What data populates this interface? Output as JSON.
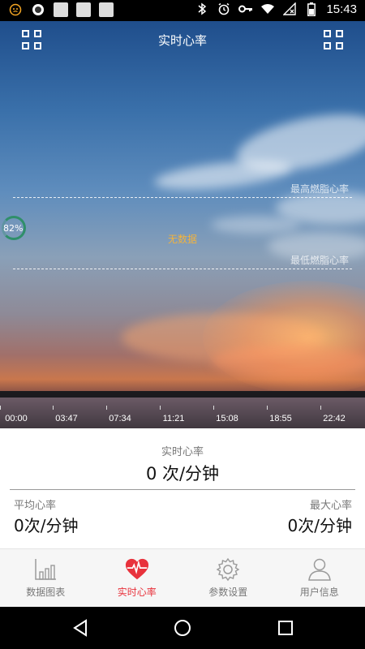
{
  "status_bar": {
    "time": "15:43",
    "left_icons": [
      "notification-face-icon",
      "record-icon",
      "app-square-icon",
      "app-square-icon",
      "app-square-icon"
    ],
    "right_icons": [
      "bluetooth-icon",
      "alarm-icon",
      "key-icon",
      "wifi-icon",
      "signal-off-icon",
      "battery-icon"
    ]
  },
  "header": {
    "title": "实时心率",
    "left_icon": "grid-icon",
    "right_icon": "grid-icon"
  },
  "chart": {
    "upper_line_label": "最高燃脂心率",
    "lower_line_label": "最低燃脂心率",
    "no_data_text": "无数据",
    "battery_percent": "82%",
    "x_ticks": [
      "00:00",
      "03:47",
      "07:34",
      "11:21",
      "15:08",
      "18:55",
      "22:42"
    ]
  },
  "readings": {
    "realtime_label": "实时心率",
    "realtime_value": "0 次/分钟",
    "average_label": "平均心率",
    "average_value": "0次/分钟",
    "max_label": "最大心率",
    "max_value": "0次/分钟"
  },
  "tabs": [
    {
      "label": "数据图表",
      "icon": "bar-chart-icon",
      "active": false
    },
    {
      "label": "实时心率",
      "icon": "heart-rate-icon",
      "active": true
    },
    {
      "label": "参数设置",
      "icon": "gear-icon",
      "active": false
    },
    {
      "label": "用户信息",
      "icon": "user-icon",
      "active": false
    }
  ],
  "colors": {
    "accent": "#e8323c",
    "no_data": "#f2b33d",
    "battery_ring": "#2f8f6a"
  }
}
